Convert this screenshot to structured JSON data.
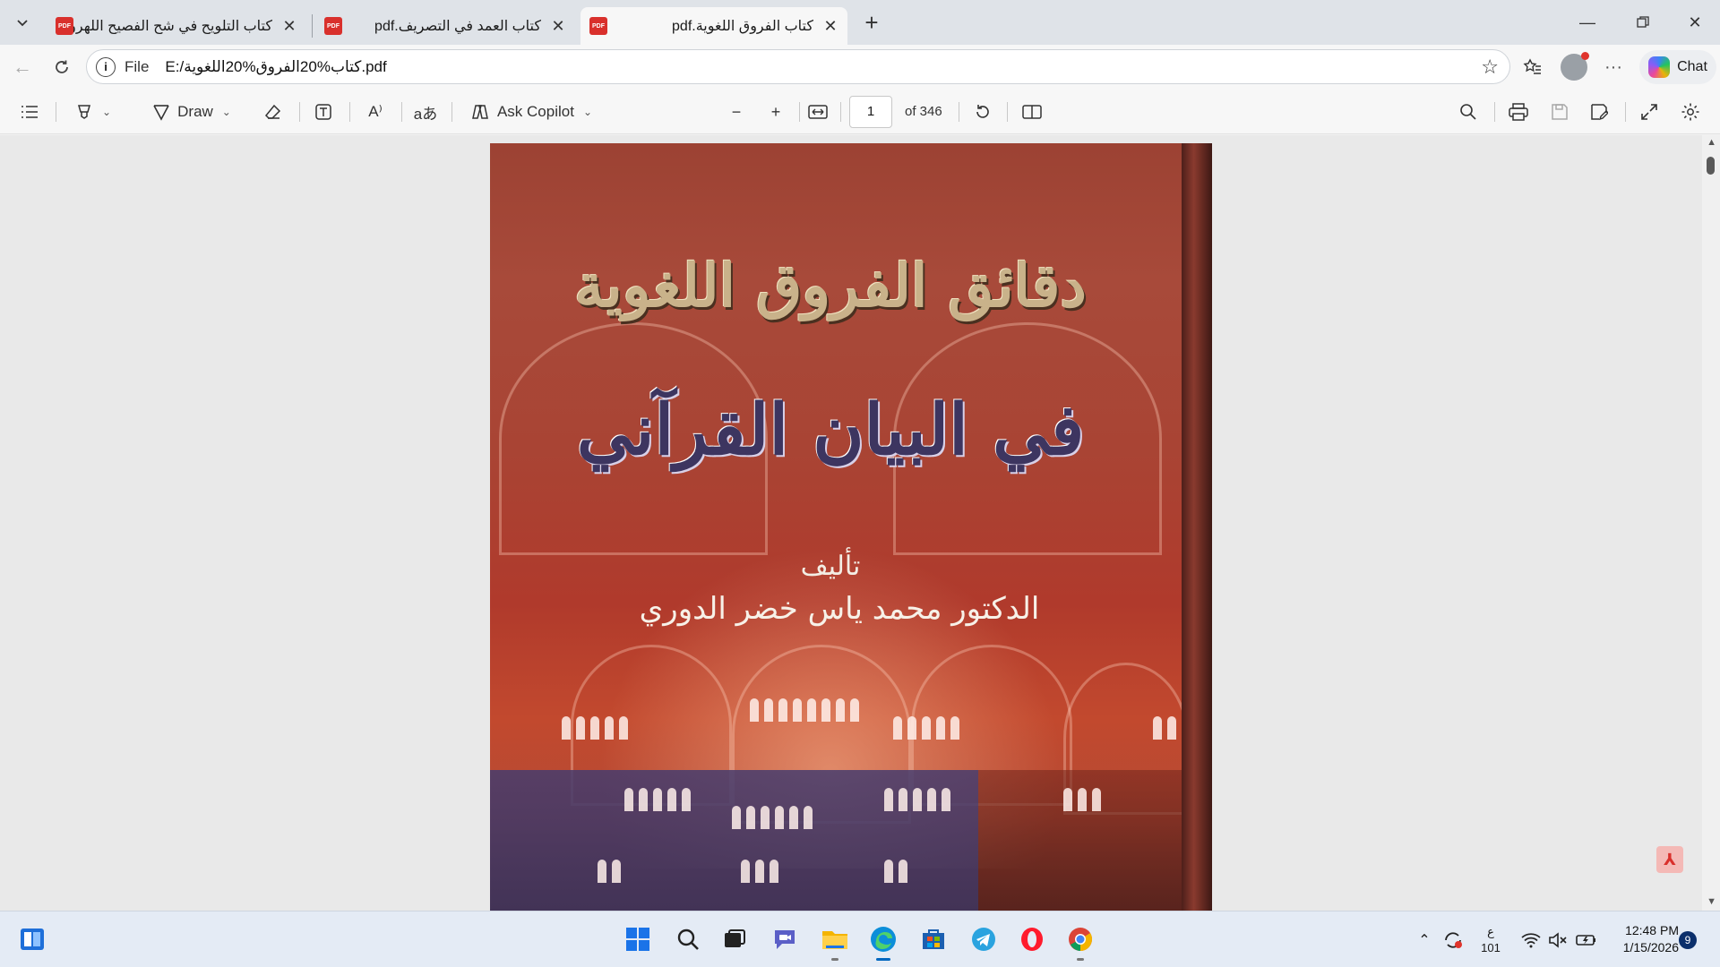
{
  "tabs": [
    {
      "title": "كتاب التلويح في شح الفصيح اللهروى",
      "active": false
    },
    {
      "title": "كتاب العمد في التصريف.pdf",
      "active": false
    },
    {
      "title": "كتاب الفروق اللغوية.pdf",
      "active": true
    }
  ],
  "tab_pdf_badge": "PDF",
  "address": {
    "scheme_label": "File",
    "url": "E:/كتاب%20الفروق%20اللغوية.pdf"
  },
  "chat_label": "Chat",
  "pdf_toolbar": {
    "draw_label": "Draw",
    "ask_copilot_label": "Ask Copilot",
    "current_page": "1",
    "page_total": "of 346"
  },
  "cover": {
    "title": "دقائق الفروق اللغوية",
    "subtitle": "في البيان القرآني",
    "author_label": "تأليف",
    "author": "الدكتور محمد ياس خضر الدوري"
  },
  "taskbar": {
    "lang_top": "ع",
    "lang_bottom": "101",
    "time": "12:48 PM",
    "date": "1/15/2026",
    "notifications": "9"
  },
  "icons": {
    "tab_list": "chevron-down-icon",
    "pdf": "pdf-file-icon",
    "close": "close-icon",
    "new_tab": "plus-icon",
    "back": "back-arrow-icon",
    "refresh": "refresh-icon",
    "info": "info-icon",
    "favorite": "star-icon"
  },
  "colors": {
    "pdf_red": "#d9302c",
    "accent": "#0067c0"
  }
}
